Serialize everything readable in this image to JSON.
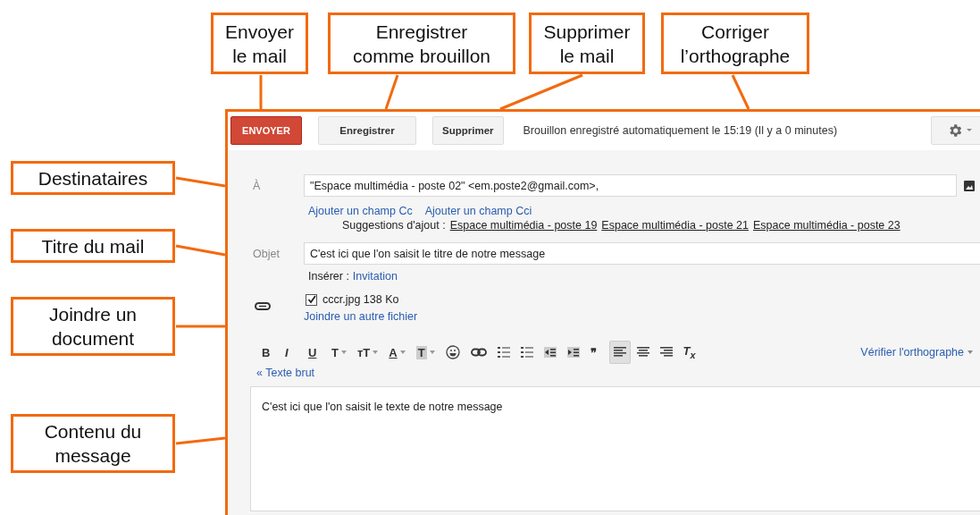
{
  "callouts_top": [
    {
      "text": "Envoyer\nle mail"
    },
    {
      "text": "Enregistrer\ncomme brouillon"
    },
    {
      "text": "Supprimer\nle mail"
    },
    {
      "text": "Corriger\nl’orthographe"
    }
  ],
  "callouts_left": [
    {
      "text": "Destinataires"
    },
    {
      "text": "Titre du mail"
    },
    {
      "text": "Joindre un\ndocument"
    },
    {
      "text": "Contenu du\nmessage"
    }
  ],
  "compose": {
    "toolbar": {
      "send": "ENVOYER",
      "save": "Enregistrer",
      "delete": "Supprimer",
      "status": "Brouillon enregistré automatiquement le 15:19 (Il y a 0 minutes)"
    },
    "to": {
      "label": "À",
      "value": "\"Espace multimédia - poste 02\" <em.poste2@gmail.com>,"
    },
    "add_links": [
      "Ajouter un champ Cc",
      "Ajouter un champ Cci"
    ],
    "suggestions": {
      "label": "Suggestions d'ajout :",
      "items": [
        "Espace multimédia - poste 19",
        "Espace multimédia - poste 21",
        "Espace multimédia - poste 23"
      ]
    },
    "subject": {
      "label": "Objet",
      "value": "C'est ici que l'on saisit le titre de notre message"
    },
    "insert": {
      "label": "Insérer :",
      "link": "Invitation"
    },
    "attachment": {
      "checked": true,
      "file": "cccr.jpg 138 Ko",
      "add_link": "Joindre un autre fichier"
    },
    "format_toolbar": [
      {
        "kind": "bold",
        "label": "B",
        "selected": false
      },
      {
        "kind": "italic",
        "label": "I",
        "selected": false
      },
      {
        "kind": "underline",
        "label": "U",
        "selected": false
      },
      {
        "kind": "font",
        "label": "T",
        "selected": false
      },
      {
        "kind": "size",
        "label": "ᴛT",
        "selected": false
      },
      {
        "kind": "text-color",
        "label": "A",
        "selected": false
      },
      {
        "kind": "highlight",
        "label": "T",
        "selected": false
      },
      {
        "kind": "smiley",
        "selected": false
      },
      {
        "kind": "link",
        "selected": false
      },
      {
        "kind": "numbered-list",
        "selected": false
      },
      {
        "kind": "bulleted-list",
        "selected": false
      },
      {
        "kind": "indent-less",
        "selected": false
      },
      {
        "kind": "indent-more",
        "selected": false
      },
      {
        "kind": "quote",
        "label": "❞",
        "selected": false
      },
      {
        "kind": "align-left",
        "selected": true
      },
      {
        "kind": "align-center",
        "selected": false
      },
      {
        "kind": "align-right",
        "selected": false
      },
      {
        "kind": "clear-format",
        "label": "T$_{x}$",
        "selected": false
      }
    ],
    "spellcheck": "Vérifier l'orthographe",
    "plain_text": "« Texte brut",
    "body": "C'est ici que l'on saisit le texte de notre message"
  }
}
